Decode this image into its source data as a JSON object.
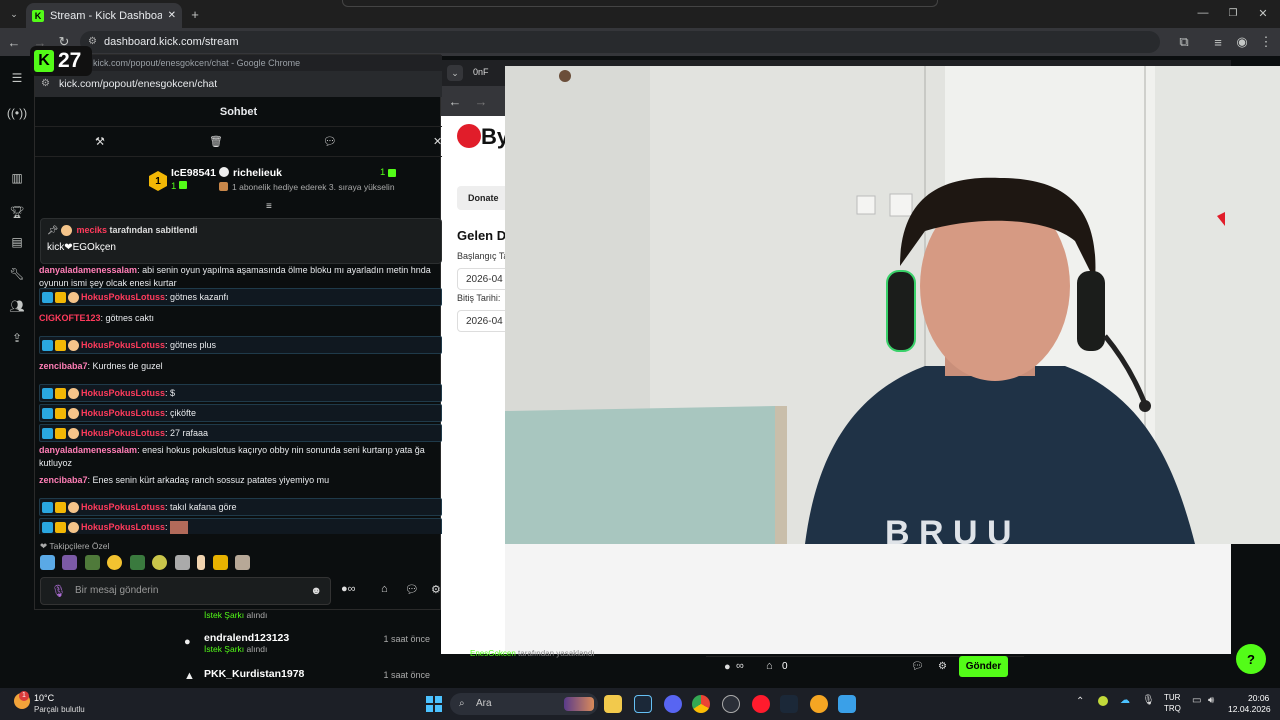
{
  "browser": {
    "tab_title": "Stream - Kick Dashboard",
    "url": "dashboard.kick.com/stream",
    "new_tab_symbol": "+",
    "close_symbol": "✕"
  },
  "viewer_badge": {
    "count": "27"
  },
  "chat_window": {
    "window_title": "kick.com/popout/enesgokcen/chat - Google Chrome",
    "url": "kick.com/popout/enesgokcen/chat",
    "header": "Sohbet",
    "leaderboard": {
      "rank": "1",
      "first_user": "IcE98541",
      "first_count": "1",
      "second_user": "richelieuk",
      "second_count": "1",
      "second_note": "1 abonelik hediye ederek 3. sıraya yükselin"
    },
    "pinned": {
      "user": "meciks",
      "suffix": "tarafından sabitlendi",
      "message": "kick❤EGOkçen"
    },
    "messages": [
      {
        "user": "danyaladamenessalam",
        "text": ": abi senin oyun yapılma aşamasında ölme bloku mı ayarladın metin hnda oyunun ismi şey olcak enesi kurtar",
        "style": "pink"
      },
      {
        "user": "HokusPokusLotuss",
        "text": ": götnes kazanfı",
        "style": "badge"
      },
      {
        "user": "CIGKOFTE123",
        "text": ": götnes caktı",
        "style": "red"
      },
      {
        "user": "HokusPokusLotuss",
        "text": ": götnes plus",
        "style": "badge"
      },
      {
        "user": "zencibaba7",
        "text": ": Kurdnes de guzel",
        "style": "pink"
      },
      {
        "user": "HokusPokusLotuss",
        "text": ": $",
        "style": "badge"
      },
      {
        "user": "HokusPokusLotuss",
        "text": ": çiköfte",
        "style": "badge"
      },
      {
        "user": "HokusPokusLotuss",
        "text": ": 27 rafaaa",
        "style": "badge"
      },
      {
        "user": "danyaladamenessalam",
        "text": ": enesi hokus pokuslotus kaçıryo obby nin sonunda seni kurtarıp yata ğa kutluyoz",
        "style": "pink"
      },
      {
        "user": "zencibaba7",
        "text": ": Enes senin kürt arkadaş ranch sossuz patates yiyemiyo mu",
        "style": "pink"
      },
      {
        "user": "HokusPokusLotuss",
        "text": ": takıl kafana göre",
        "style": "badge"
      },
      {
        "user": "HokusPokusLotuss",
        "text": ":",
        "style": "badge"
      }
    ],
    "emote_section": "Takipçilere Özel",
    "input_placeholder": "Bir mesaj gönderin"
  },
  "donate_window": {
    "tab_label": "0nF",
    "brand": "By",
    "donate_button": "Donate",
    "heading": "Gelen D",
    "start_label": "Başlangıç Ta",
    "start_value": "2026-04",
    "end_label": "Bitiş Tarihi:",
    "end_value": "2026-04"
  },
  "events": [
    {
      "sub": "İstek Şarkı",
      "sub_suffix": "alındı"
    },
    {
      "name": "endralend123123",
      "time": "1 saat önce",
      "sub": "İstek Şarkı",
      "sub_suffix": "alındı"
    },
    {
      "name": "PKK_Kurdistan1978",
      "time": "1 saat önce"
    }
  ],
  "dashboard_bottom": {
    "banned_user": "EnesGokcen",
    "banned_suffix": "tarafından yasaklandı",
    "infinite": "∞",
    "zero": "0",
    "send_button": "Gönder"
  },
  "taskbar": {
    "weather_temp": "10°C",
    "weather_desc": "Parçalı bulutlu",
    "search_placeholder": "Ara",
    "lang_top": "TUR",
    "lang_bottom": "TRQ",
    "time": "20:06",
    "date": "12.04.2026",
    "notif_count": "1"
  },
  "colors": {
    "kick_green": "#53fc18",
    "accent_red": "#ff3b5c"
  }
}
